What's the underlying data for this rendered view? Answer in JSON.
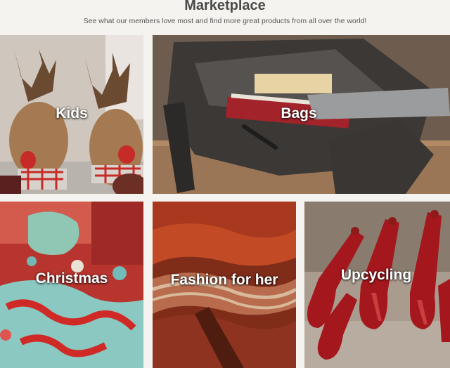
{
  "header": {
    "title": "Marketplace",
    "subtitle": "See what our members love most and find more great products from all over the world!"
  },
  "categories": [
    {
      "label": "Kids",
      "image": "reindeer-plush-toys"
    },
    {
      "label": "Bags",
      "image": "leather-messenger-bag-with-books"
    },
    {
      "label": "Christmas",
      "image": "felt-christmas-ornaments"
    },
    {
      "label": "Fashion for her",
      "image": "knitted-scarf"
    },
    {
      "label": "Upcycling",
      "image": "red-bottle-lamps"
    }
  ],
  "colors": {
    "background": "#f4f3ef",
    "title": "#4a4a4a",
    "label": "#ffffff"
  }
}
